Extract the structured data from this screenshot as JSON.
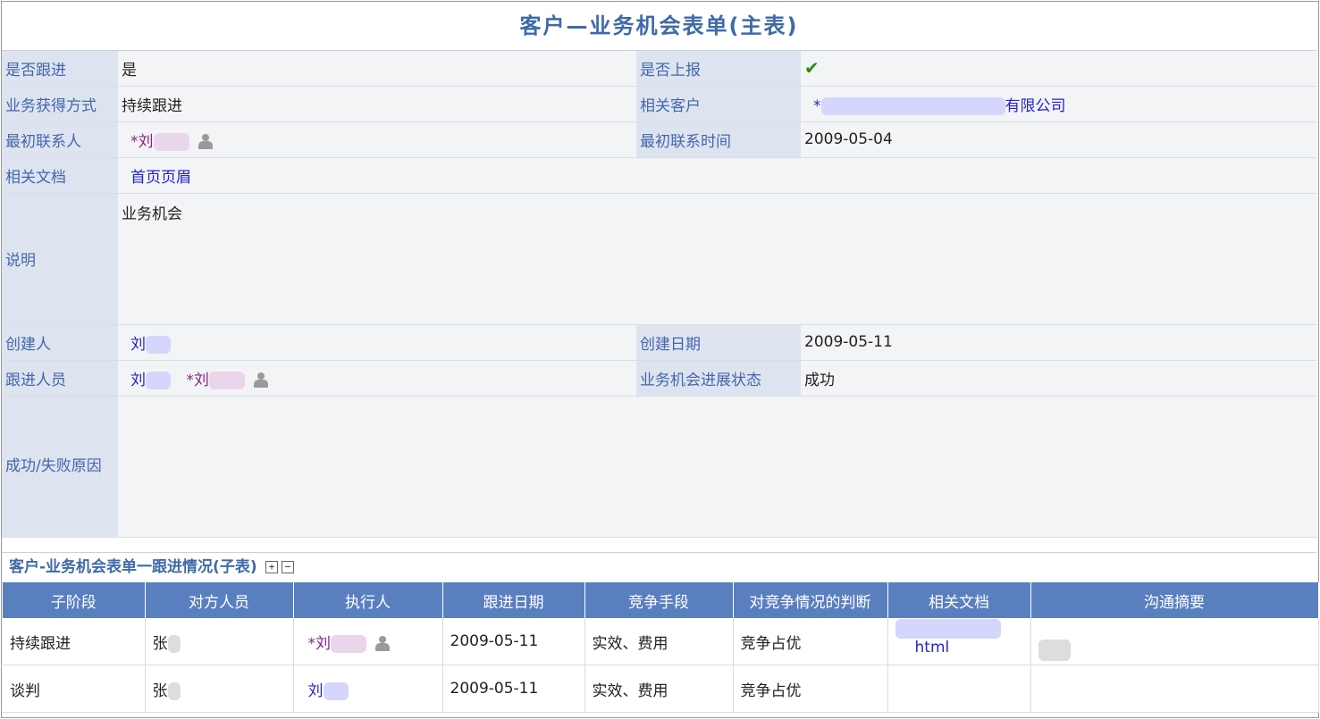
{
  "title": "客户—业务机会表单(主表)",
  "main": {
    "r1": {
      "l1": "是否跟进",
      "v1": "是",
      "l2": "是否上报",
      "v2": "✔"
    },
    "r2": {
      "l1": "业务获得方式",
      "v1": "持续跟进",
      "l2": "相关客户",
      "v2_prefix": "*",
      "v2_suffix": "有限公司"
    },
    "r3": {
      "l1": "最初联系人",
      "v1": "*刘",
      "l2": "最初联系时间",
      "v2": "2009-05-04"
    },
    "r4": {
      "l1": "相关文档",
      "v1": "首页页眉"
    },
    "r5": {
      "l1": "说明",
      "v1": "业务机会"
    },
    "r6": {
      "l1": "创建人",
      "v1": "刘",
      "l2": "创建日期",
      "v2": "2009-05-11"
    },
    "r7": {
      "l1": "跟进人员",
      "v1a": "刘",
      "v1b": "*刘",
      "l2": "业务机会进展状态",
      "v2": "成功"
    },
    "r8": {
      "l1": "成功/失败原因",
      "v1": ""
    }
  },
  "subtitle": "客户-业务机会表单一跟进情况(子表)",
  "toggles": {
    "expand": "+",
    "collapse": "−"
  },
  "sub": {
    "headers": [
      "子阶段",
      "对方人员",
      "执行人",
      "跟进日期",
      "竞争手段",
      "对竞争情况的判断",
      "相关文档",
      "沟通摘要"
    ],
    "rows": [
      {
        "stage": "持续跟进",
        "party": "张",
        "exec": "*刘",
        "date": "2009-05-11",
        "means": "实效、费用",
        "judge": "竞争占优",
        "doc": "html",
        "summary": ""
      },
      {
        "stage": "谈判",
        "party": "张",
        "exec": "刘",
        "date": "2009-05-11",
        "means": "实效、费用",
        "judge": "竞争占优",
        "doc": "",
        "summary": ""
      }
    ]
  }
}
